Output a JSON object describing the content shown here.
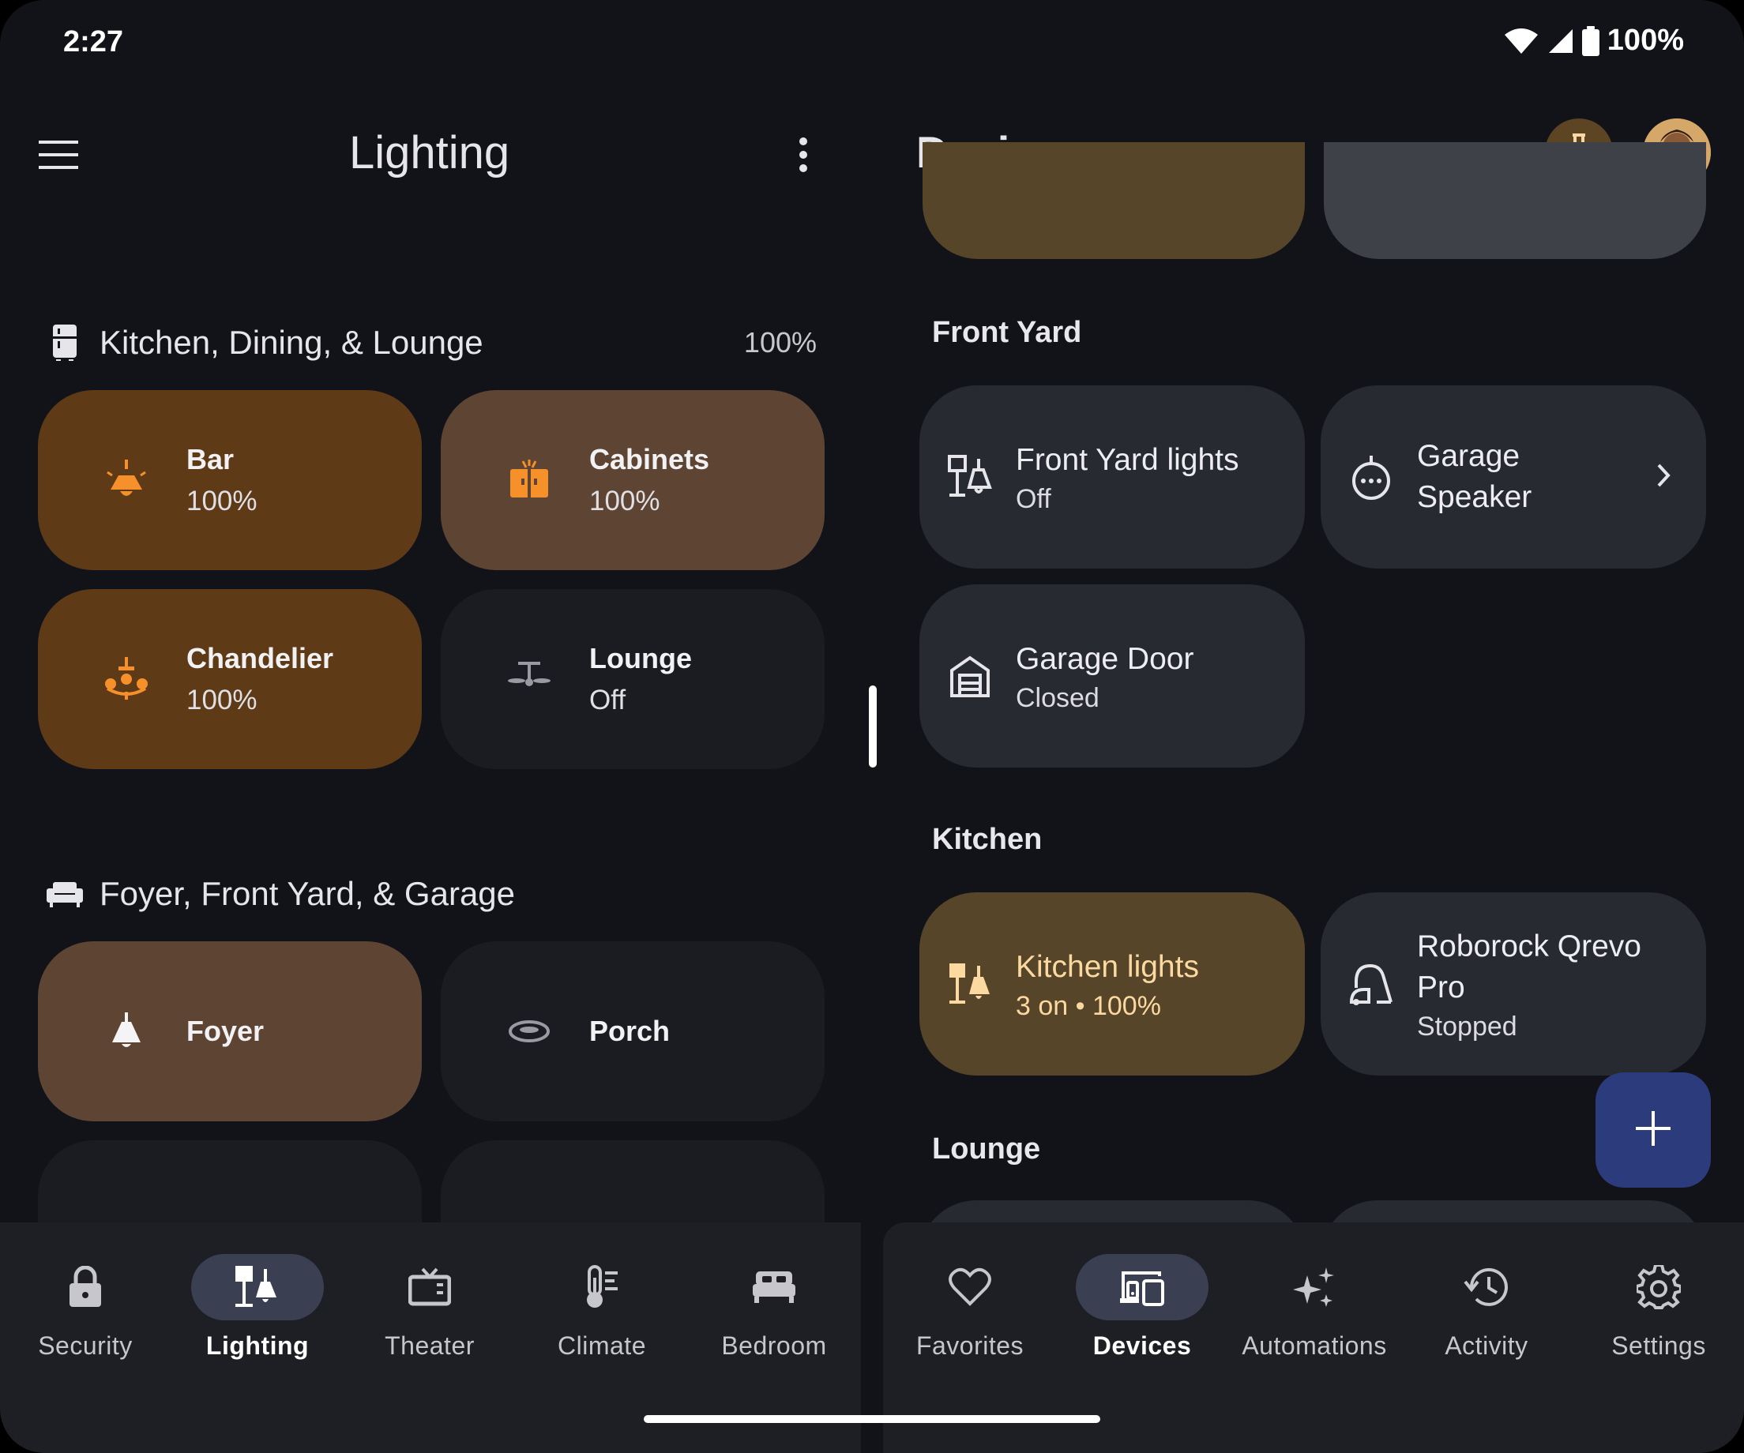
{
  "status": {
    "time": "2:27",
    "battery": "100%"
  },
  "left": {
    "title": "Lighting",
    "sections": [
      {
        "title": "Kitchen, Dining, & Lounge",
        "percent": "100%",
        "tiles": [
          {
            "name": "Bar",
            "status": "100%",
            "icon": "ceiling-pendant-icon"
          },
          {
            "name": "Cabinets",
            "status": "100%",
            "icon": "cabinet-light-icon"
          },
          {
            "name": "Chandelier",
            "status": "100%",
            "icon": "chandelier-icon"
          },
          {
            "name": "Lounge",
            "status": "Off",
            "icon": "ceiling-fan-icon"
          }
        ]
      },
      {
        "title": "Foyer, Front Yard, & Garage",
        "tiles": [
          {
            "name": "Foyer",
            "icon": "pendant-lamp-icon"
          },
          {
            "name": "Porch",
            "icon": "flush-mount-light-icon"
          }
        ]
      }
    ],
    "nav": [
      {
        "label": "Security",
        "icon": "lock-icon"
      },
      {
        "label": "Lighting",
        "icon": "lamp-icon",
        "active": true
      },
      {
        "label": "Theater",
        "icon": "tv-icon"
      },
      {
        "label": "Climate",
        "icon": "thermometer-icon"
      },
      {
        "label": "Bedroom",
        "icon": "bed-icon"
      }
    ]
  },
  "right": {
    "title": "Devices",
    "sections": [
      {
        "title": "Front Yard",
        "devices": [
          {
            "name": "Front Yard lights",
            "status": "Off",
            "icon": "lights-group-icon"
          },
          {
            "name": "Garage\nSpeaker",
            "status": "",
            "icon": "speaker-icon"
          },
          {
            "name": "Garage Door",
            "status": "Closed",
            "icon": "garage-icon"
          }
        ]
      },
      {
        "title": "Kitchen",
        "devices": [
          {
            "name": "Kitchen lights",
            "status": "3 on • 100%",
            "icon": "lights-group-icon"
          },
          {
            "name": "Roborock Qrevo\nPro",
            "status": "Stopped",
            "icon": "vacuum-icon"
          }
        ]
      },
      {
        "title": "Lounge",
        "devices": []
      }
    ],
    "nav": [
      {
        "label": "Favorites",
        "icon": "heart-icon"
      },
      {
        "label": "Devices",
        "icon": "devices-icon",
        "active": true
      },
      {
        "label": "Automations",
        "icon": "sparkle-icon"
      },
      {
        "label": "Activity",
        "icon": "history-icon"
      },
      {
        "label": "Settings",
        "icon": "gear-icon"
      }
    ]
  },
  "colors": {
    "background": "#111318",
    "tile_on_dark": "#5f3a17",
    "tile_on_mid": "#5e4433",
    "tile_off": "#1b1c21",
    "device_tile": "#272a31",
    "kitchen_tile": "#574529",
    "accent_orange": "#f5902a",
    "fab": "#2c3b7b"
  }
}
